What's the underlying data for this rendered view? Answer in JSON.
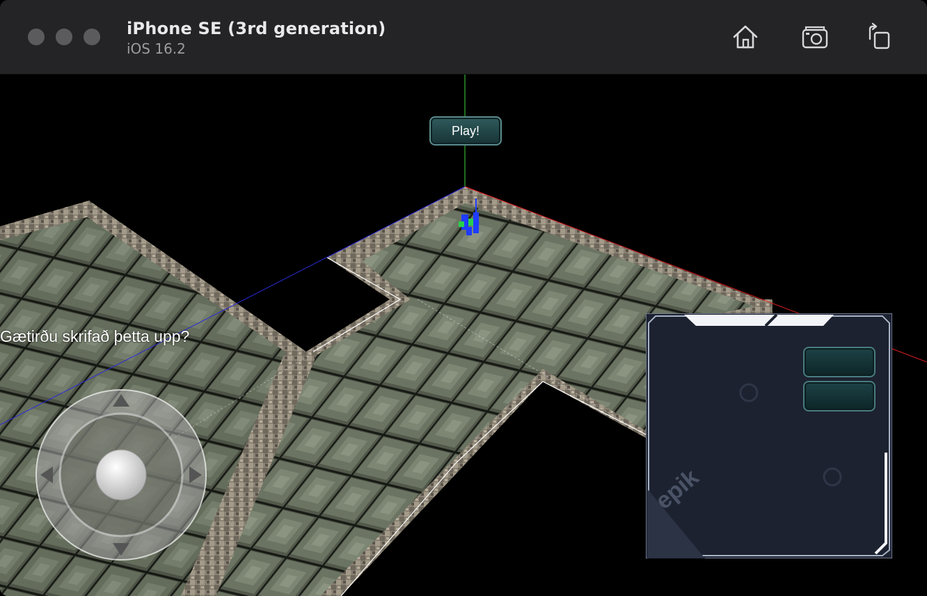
{
  "window": {
    "title": "iPhone SE (3rd generation)",
    "subtitle": "iOS 16.2"
  },
  "toolbar": {
    "home_icon": "home-icon",
    "screenshot_icon": "camera-icon",
    "rotate_icon": "rotate-icon"
  },
  "game": {
    "play_label": "Play!",
    "subtitle_text": "Gætirðu skrifað þetta upp?",
    "watermark": "epik"
  },
  "colors": {
    "titlebar": "#242426",
    "floor_tile": "#5e6656",
    "wall_stone": "#8a8274",
    "button_teal": "#1d4246",
    "panel_bg": "#1c2230"
  }
}
